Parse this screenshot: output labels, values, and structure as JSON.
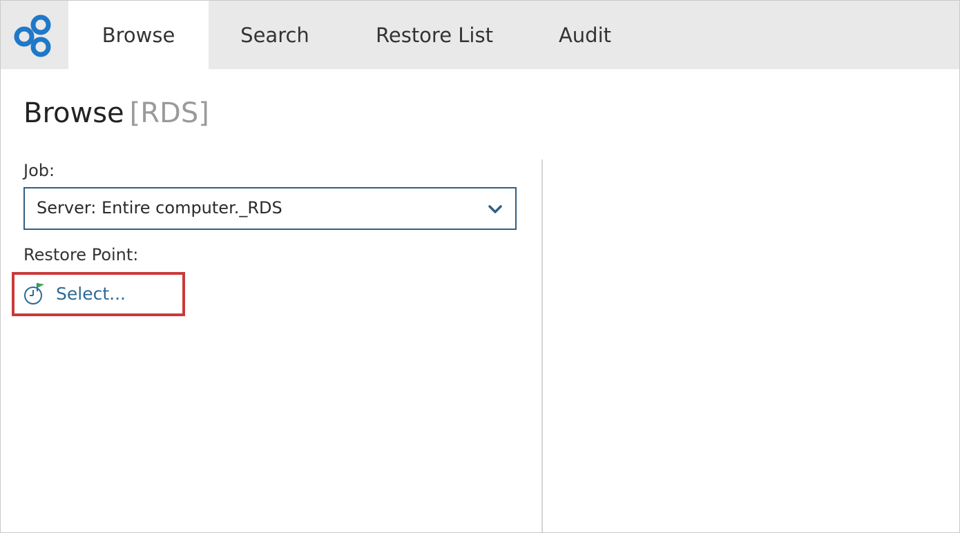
{
  "nav": {
    "tabs": [
      {
        "label": "Browse",
        "active": true
      },
      {
        "label": "Search",
        "active": false
      },
      {
        "label": "Restore List",
        "active": false
      },
      {
        "label": "Audit",
        "active": false
      }
    ]
  },
  "page": {
    "title": "Browse",
    "context": "[RDS]"
  },
  "form": {
    "job_label": "Job:",
    "job_value": "Server: Entire computer._RDS",
    "restore_point_label": "Restore Point:",
    "restore_point_link": "Select..."
  },
  "colors": {
    "brand_blue": "#1f78c8",
    "link_blue": "#2d6a93",
    "select_border": "#2f5f80",
    "highlight_red": "#c93a3a",
    "flag_green": "#3aa34a"
  },
  "icons": {
    "logo": "brand-logo-icon",
    "dropdown": "chevron-down-icon",
    "restore_point": "restore-point-flag-icon"
  }
}
